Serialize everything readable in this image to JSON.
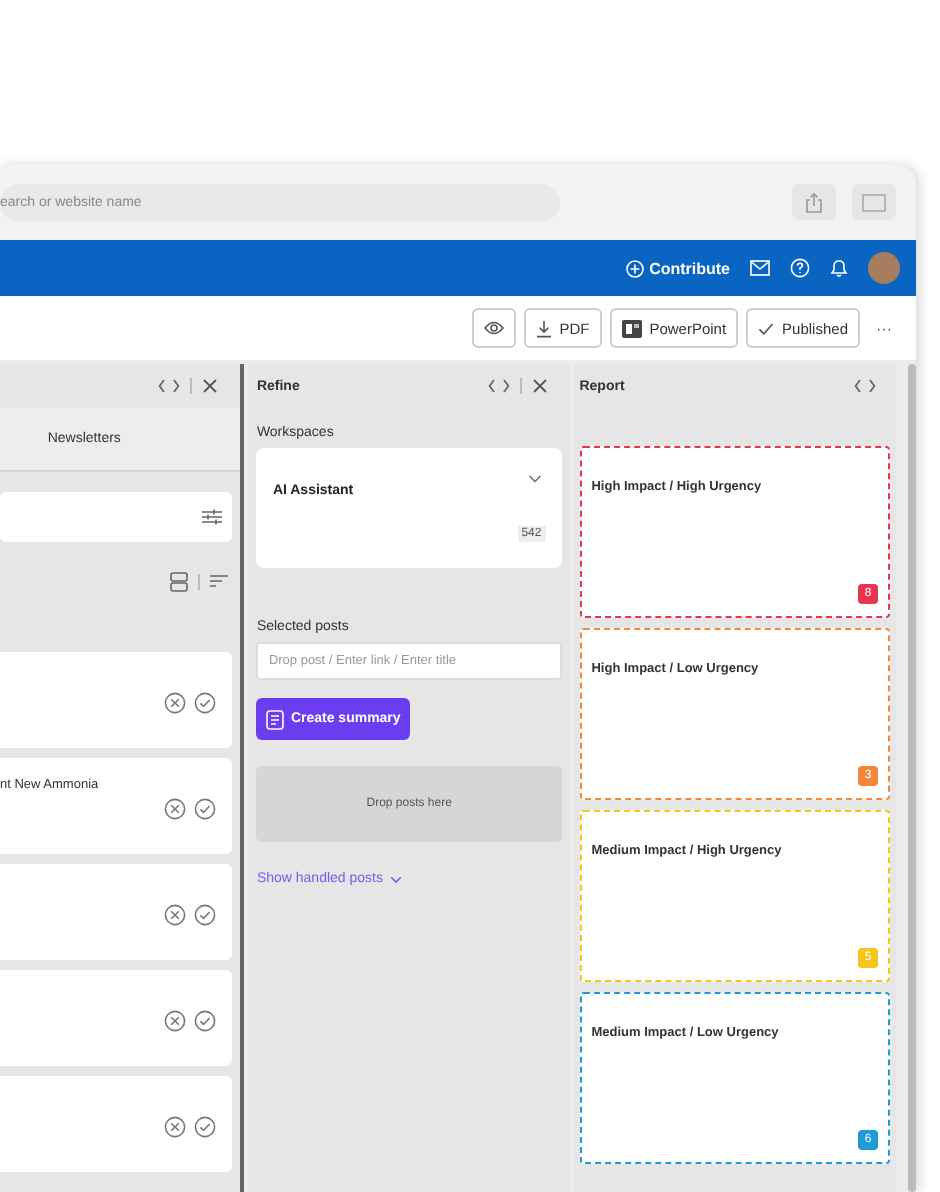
{
  "address_bar": {
    "placeholder": "earch or website name"
  },
  "header": {
    "contribute": "Contribute"
  },
  "toolbar": {
    "pdf": "PDF",
    "powerpoint": "PowerPoint",
    "published": "Published",
    "more": "···"
  },
  "left_panel": {
    "tab": "Newsletters",
    "posts": [
      {
        "kind": "post"
      },
      {
        "kind": "post",
        "title": "nt New Ammonia"
      },
      {
        "kind": "post"
      },
      {
        "kind": "post"
      },
      {
        "kind": "post"
      }
    ]
  },
  "refine": {
    "title": "Refine",
    "workspaces_label": "Workspaces",
    "workspace": {
      "name": "AI Assistant",
      "count": "542"
    },
    "selected_posts_label": "Selected posts",
    "input": {
      "placeholder": "Drop post / Enter link / Enter title"
    },
    "create_button": "Create summary",
    "dropzone": "Drop posts here",
    "show_handled": "Show handled posts"
  },
  "report": {
    "title": "Report",
    "quadrants": [
      {
        "title": "High Impact / High Urgency",
        "count": "8",
        "color": "#e5354f"
      },
      {
        "title": "High Impact / Low Urgency",
        "count": "3",
        "color": "#f4883a"
      },
      {
        "title": "Medium Impact / High Urgency",
        "count": "5",
        "color": "#f5c518"
      },
      {
        "title": "Medium Impact / Low Urgency",
        "count": "6",
        "color": "#1e9bd7"
      }
    ]
  }
}
